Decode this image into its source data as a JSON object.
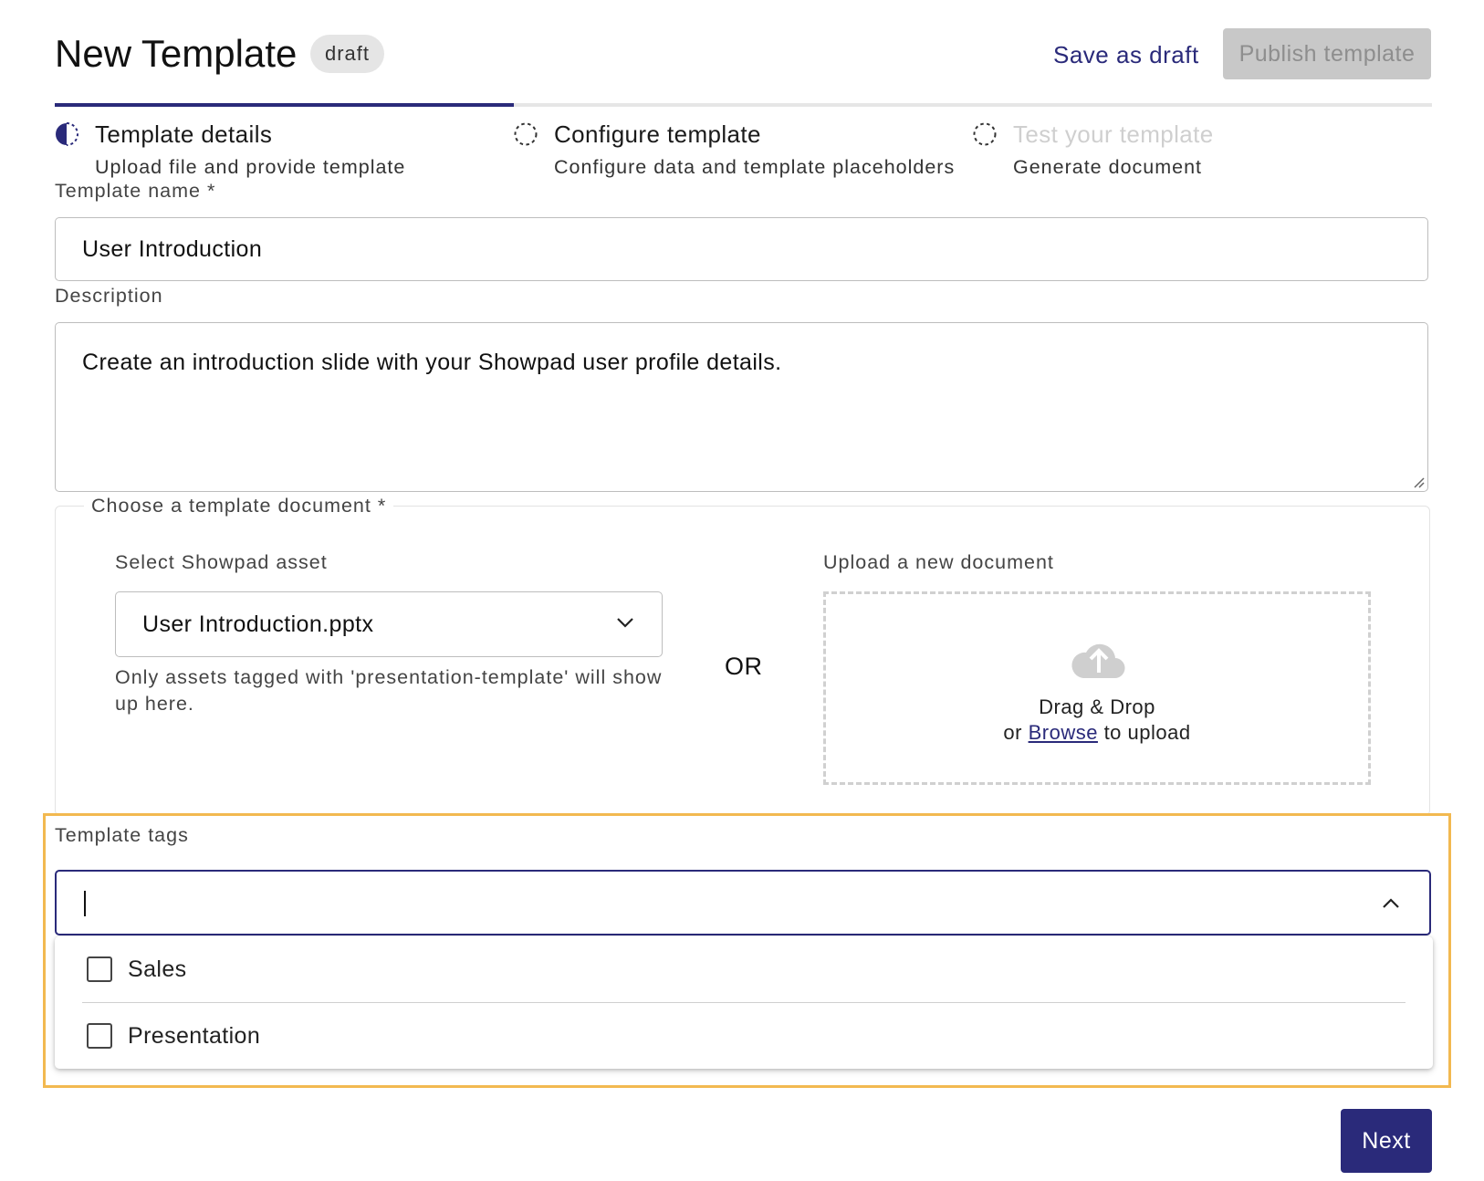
{
  "header": {
    "title": "New Template",
    "status_badge": "draft",
    "save_draft_label": "Save as draft",
    "publish_label": "Publish template"
  },
  "stepper": {
    "steps": [
      {
        "name": "Template details",
        "subtitle": "Upload file and provide template",
        "state": "in-progress"
      },
      {
        "name": "Configure template",
        "subtitle": "Configure data and template placeholders",
        "state": "pending"
      },
      {
        "name": "Test your template",
        "subtitle": "Generate document",
        "state": "disabled"
      }
    ],
    "progress_fraction": 0.333
  },
  "form": {
    "template_name": {
      "label": "Template name *",
      "value": "User Introduction"
    },
    "description": {
      "label": "Description",
      "value": "Create an introduction slide with your Showpad user profile details."
    },
    "document": {
      "legend": "Choose a template document *",
      "asset_label": "Select Showpad asset",
      "asset_value": "User Introduction.pptx",
      "asset_hint": "Only assets tagged with 'presentation-template' will show up here.",
      "or_label": "OR",
      "upload_label": "Upload a new document",
      "drag_drop": "Drag & Drop",
      "or_prefix": "or",
      "browse_link": "Browse",
      "upload_suffix": "to upload"
    },
    "tags": {
      "label": "Template tags",
      "value": "",
      "options": [
        {
          "label": "Sales",
          "checked": false
        },
        {
          "label": "Presentation",
          "checked": false
        }
      ]
    }
  },
  "footer": {
    "next_label": "Next"
  },
  "colors": {
    "accent": "#2a2a7a",
    "highlight": "#f2b950",
    "disabled_button": "#c8c8c8"
  },
  "icons": [
    "half-circle-progress-icon",
    "dashed-circle-icon",
    "chevron-down-icon",
    "cloud-upload-icon",
    "chevron-up-icon",
    "checkbox-icon",
    "resize-handle-icon"
  ]
}
